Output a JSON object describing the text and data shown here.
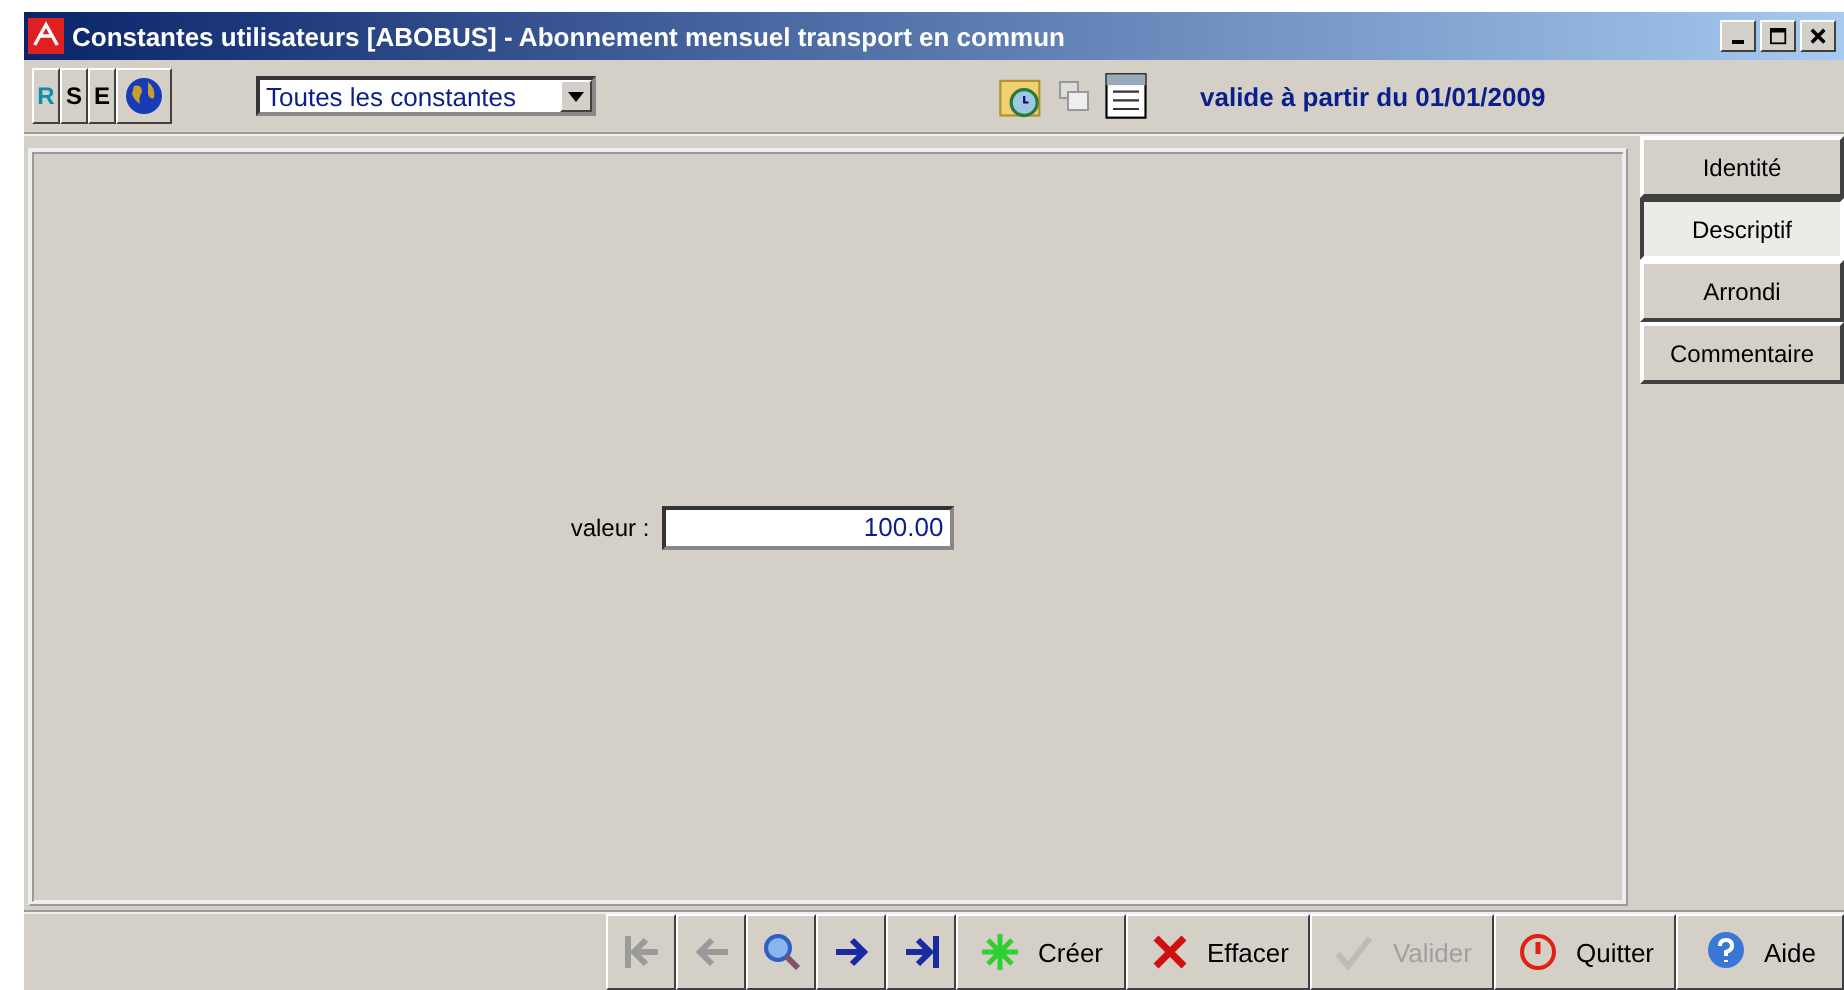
{
  "window": {
    "title": "Constantes utilisateurs  [ABOBUS] - Abonnement mensuel transport en commun"
  },
  "toolbar": {
    "mode_buttons": [
      {
        "label": "R",
        "selected": true
      },
      {
        "label": "S",
        "selected": false
      },
      {
        "label": "E",
        "selected": false
      }
    ],
    "filter": {
      "value": "Toutes les constantes"
    },
    "validity": "valide à partir du 01/01/2009"
  },
  "form": {
    "fields": [
      {
        "label": "valeur :",
        "value": "100.00"
      }
    ]
  },
  "side_tabs": [
    {
      "label": "Identité",
      "selected": false
    },
    {
      "label": "Descriptif",
      "selected": true
    },
    {
      "label": "Arrondi",
      "selected": false
    },
    {
      "label": "Commentaire",
      "selected": false
    }
  ],
  "nav_buttons": [
    {
      "kind": "first",
      "disabled": true
    },
    {
      "kind": "prev",
      "disabled": true
    },
    {
      "kind": "search",
      "disabled": false
    },
    {
      "kind": "next",
      "disabled": false
    },
    {
      "kind": "last",
      "disabled": false
    }
  ],
  "action_buttons": [
    {
      "kind": "create",
      "label": "Créer",
      "disabled": false
    },
    {
      "kind": "delete",
      "label": "Effacer",
      "disabled": false
    },
    {
      "kind": "validate",
      "label": "Valider",
      "disabled": true
    },
    {
      "kind": "quit",
      "label": "Quitter",
      "disabled": false
    },
    {
      "kind": "help",
      "label": "Aide",
      "disabled": false
    }
  ]
}
